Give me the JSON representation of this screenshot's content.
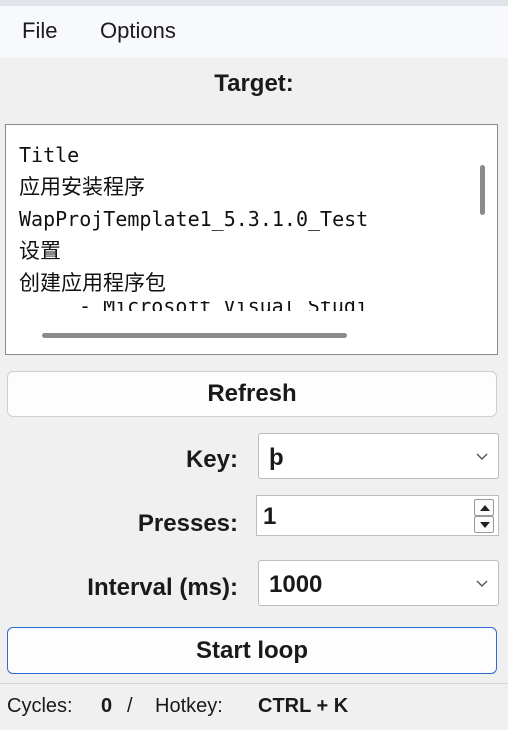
{
  "menu": {
    "items": [
      "File",
      "Options"
    ]
  },
  "target": {
    "title": "Target:",
    "lines": [
      "Title",
      "应用安装程序",
      "WapProjTemplate1_5.3.1.0_Test",
      "设置",
      "创建应用程序包",
      "- Microsoft Visual Studi"
    ]
  },
  "buttons": {
    "refresh": "Refresh",
    "start_loop": "Start loop"
  },
  "key": {
    "label": "Key:",
    "value": "þ"
  },
  "presses": {
    "label": "Presses:",
    "value": "1"
  },
  "interval": {
    "label": "Interval (ms):",
    "value": "1000"
  },
  "status": {
    "cycles_label": "Cycles:",
    "cycles_value": "0",
    "separator": "/",
    "hotkey_label": "Hotkey:",
    "hotkey_value": "CTRL + K"
  },
  "colors": {
    "accent": "#2d6ad1",
    "background": "#f0f0f0"
  }
}
